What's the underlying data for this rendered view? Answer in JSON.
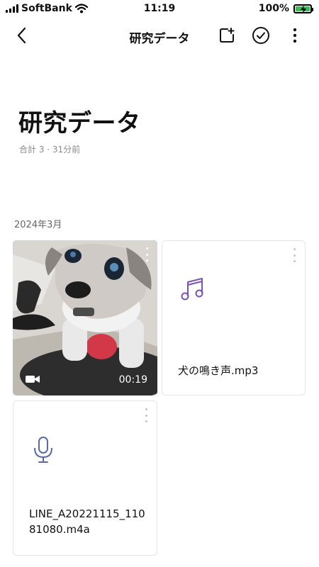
{
  "status_bar": {
    "carrier": "SoftBank",
    "time": "11:19",
    "battery": "100%",
    "battery_level": 1.0,
    "battery_color": "#2fc24e"
  },
  "nav": {
    "title": "研究データ",
    "icons": [
      "back-chevron-icon",
      "add-to-album-icon",
      "select-check-icon",
      "more-vertical-icon"
    ]
  },
  "album": {
    "title": "研究データ",
    "meta": "合計 3 · 31分前"
  },
  "section": {
    "date": "2024年3月"
  },
  "items": [
    {
      "type": "video",
      "duration": "00:19",
      "icon": "video-camera-icon"
    },
    {
      "type": "audio",
      "name": "犬の鳴き声.mp3",
      "icon": "music-note-icon",
      "accent": "#7a55b0"
    },
    {
      "type": "voice",
      "name": "LINE_A20221115_11081080.m4a",
      "icon": "microphone-icon",
      "accent": "#5a6aa8"
    }
  ]
}
